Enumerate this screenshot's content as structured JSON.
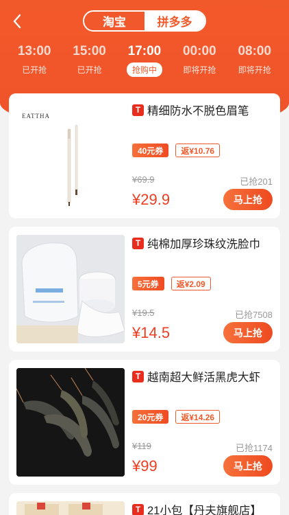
{
  "platform_tabs": [
    "淘宝",
    "拼多多"
  ],
  "time_slots": [
    {
      "time": "13:00",
      "status": "已开抢"
    },
    {
      "time": "15:00",
      "status": "已开抢"
    },
    {
      "time": "17:00",
      "status": "抢购中"
    },
    {
      "time": "00:00",
      "status": "即将开抢"
    },
    {
      "time": "08:00",
      "status": "即将开抢"
    }
  ],
  "platform_badge": "T",
  "buy_label": "马上抢",
  "products": [
    {
      "title": "精细防水不脱色眉笔",
      "coupon": "40元券",
      "rebate": "返¥10.76",
      "orig_price": "¥69.9",
      "sold": "已抢201",
      "price": "¥29.9",
      "brand_text": "EATTHA"
    },
    {
      "title": "纯棉加厚珍珠纹洗脸巾",
      "coupon": "5元券",
      "rebate": "返¥2.09",
      "orig_price": "¥19.5",
      "sold": "已抢7508",
      "price": "¥14.5"
    },
    {
      "title": "越南超大鲜活黑虎大虾",
      "coupon": "20元券",
      "rebate": "返¥14.26",
      "orig_price": "¥119",
      "sold": "已抢1174",
      "price": "¥99"
    },
    {
      "title": "21小包【丹夫旗舰店】"
    }
  ]
}
